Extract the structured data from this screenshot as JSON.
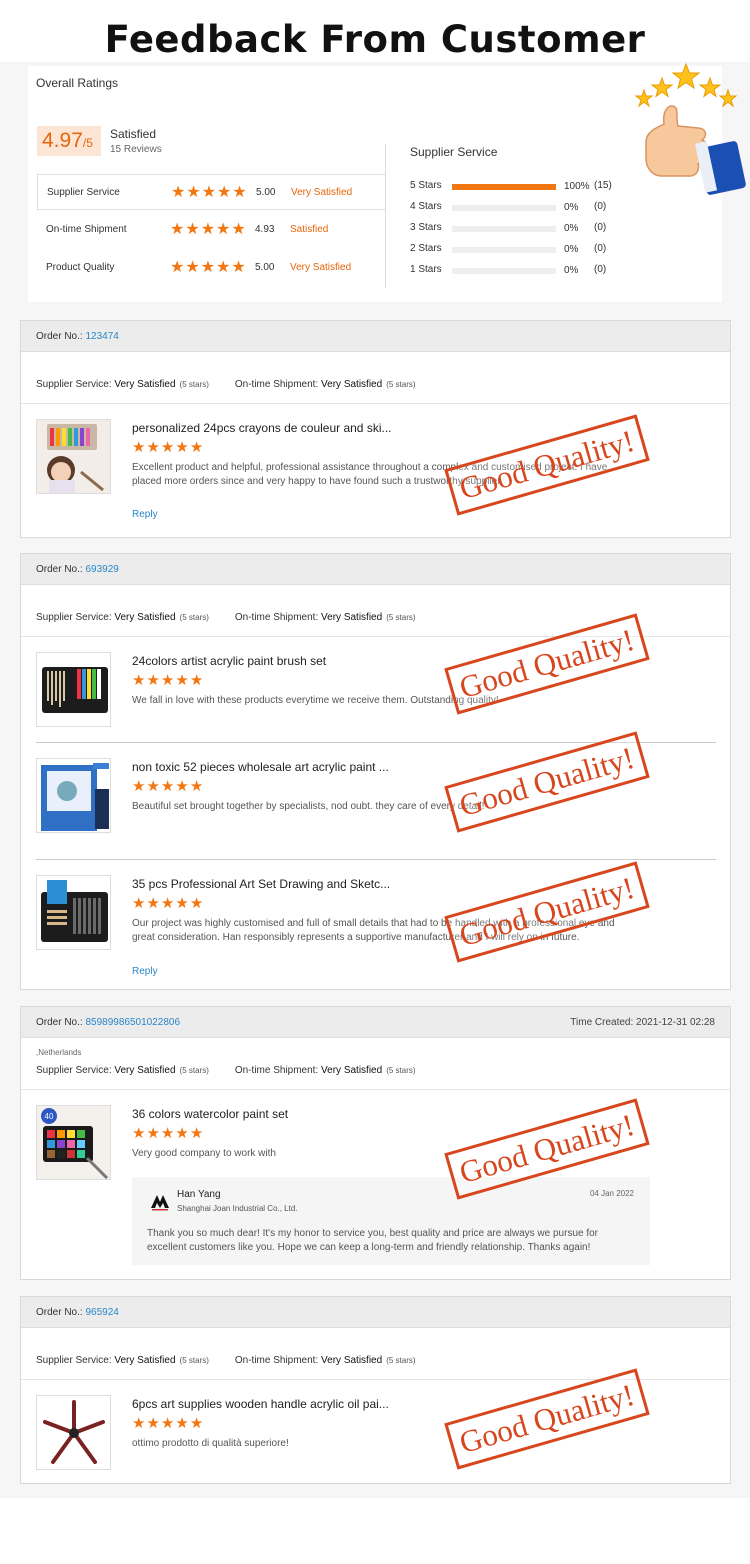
{
  "banner": {
    "title": "Feedback From Customer"
  },
  "ratings": {
    "title": "Overall Ratings",
    "score": "4.97",
    "score_suffix": "/5",
    "satisfaction": "Satisfied",
    "reviews": "15 Reviews",
    "metrics": [
      {
        "label": "Supplier Service",
        "stars": 5,
        "value": "5.00",
        "word": "Very Satisfied"
      },
      {
        "label": "On-time Shipment",
        "stars": 5,
        "value": "4.93",
        "word": "Satisfied"
      },
      {
        "label": "Product Quality",
        "stars": 5,
        "value": "5.00",
        "word": "Very Satisfied"
      }
    ],
    "distribution": {
      "title": "Supplier Service",
      "rows": [
        {
          "label": "5 Stars",
          "pct": "100%",
          "fill": 1.0,
          "count": "(15)"
        },
        {
          "label": "4 Stars",
          "pct": "0%",
          "fill": 0,
          "count": "(0)"
        },
        {
          "label": "3 Stars",
          "pct": "0%",
          "fill": 0,
          "count": "(0)"
        },
        {
          "label": "2 Stars",
          "pct": "0%",
          "fill": 0,
          "count": "(0)"
        },
        {
          "label": "1 Stars",
          "pct": "0%",
          "fill": 0,
          "count": "(0)"
        }
      ]
    }
  },
  "common": {
    "order_label": "Order No.:",
    "supplier_service_label": "Supplier Service:",
    "on_time_label": "On-time Shipment:",
    "very_satisfied": "Very Satisfied",
    "five_stars": "(5 stars)",
    "reply_label": "Reply",
    "stamp_text": "Good Quality!",
    "star_glyph": "★"
  },
  "orders": [
    {
      "order_no": "123474",
      "items": [
        {
          "name": "personalized 24pcs crayons de couleur and ski...",
          "review": "Excellent product and helpful, professional assistance throughout a complex and customised project. I have placed more orders since and very happy to have found such a trustworthy supplier."
        }
      ]
    },
    {
      "order_no": "693929",
      "items": [
        {
          "name": "24colors artist acrylic paint brush set",
          "review": "We fall in love with these products everytime we receive them. Outstanding quality!"
        },
        {
          "name": "non toxic 52 pieces wholesale art acrylic paint ...",
          "review": "Beautiful set brought together by specialists, nod oubt. they care of every detail!"
        },
        {
          "name": "35 pcs Professional Art Set Drawing and Sketc...",
          "review": "Our project was highly customised and full of small details that had to be handled with a professional eye and great consideration. Han responsibly represents a supportive manufacturer and I will rely on in future."
        }
      ]
    },
    {
      "order_no": "85989986501022806",
      "time_created": "Time Created: 2021-12-31 02:28",
      "location": ",Netherlands",
      "items": [
        {
          "name": "36 colors watercolor paint set",
          "review": "Very good company to work with"
        }
      ],
      "seller_reply": {
        "name": "Han Yang",
        "company": "Shanghai Joan Industrial Co., Ltd.",
        "date": "04 Jan 2022",
        "text": "Thank you so much dear! It's my honor to service you, best quality and price are always we pursue for excellent customers like you. Hope we can keep a long-term and friendly relationship. Thanks again!"
      }
    },
    {
      "order_no": "965924",
      "items": [
        {
          "name": "6pcs art supplies wooden handle acrylic oil pai...",
          "review": "ottimo prodotto di qualità superiore!"
        }
      ]
    }
  ],
  "image_badge": "40",
  "colors": {
    "accent": "#f27712",
    "link": "#2a86c8",
    "stamp": "#d8461e"
  }
}
